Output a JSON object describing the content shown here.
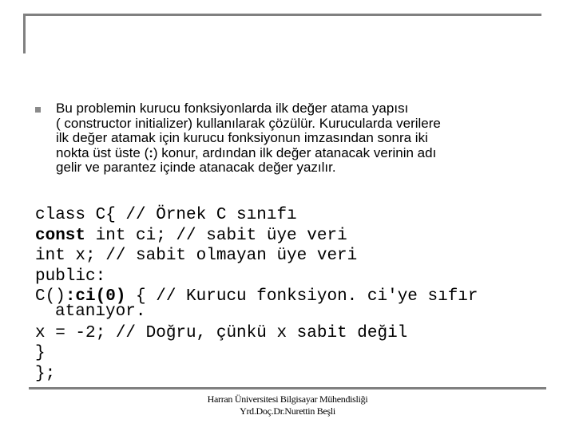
{
  "slide": {
    "bullet_icon": "square-bullet-icon",
    "bullet_lines": [
      "Bu problemin kurucu fonksiyonlarda ilk değer atama yapısı",
      "( constructor initializer) kullanılarak çözülür. Kurucularda verilere",
      "ilk değer atamak için kurucu fonksiyonun imzasından sonra iki",
      "nokta üst üste (",
      ":",
      ") konur, ardından ilk değer atanacak verinin adı",
      "gelir ve parantez içinde atanacak değer yazılır."
    ],
    "code": {
      "line1": "class C{ // Örnek C sınıfı",
      "line2_bold": "const",
      "line2_rest": " int ci; // sabit üye veri",
      "line3": "int x; // sabit olmayan üye veri",
      "line4": "public:",
      "line5_pre": "C()",
      "line5_bold": ":ci(0)",
      "line5_rest": " { // Kurucu fonksiyon. ci'ye sıfır",
      "line5_wrap": "atanıyor.",
      "line6": "x = -2; // Doğru, çünkü x sabit değil",
      "line7": "}",
      "line8": "};"
    },
    "footer": {
      "line1": "Harran Üniversitesi Bilgisayar Mühendisliği",
      "line2": "Yrd.Doç.Dr.Nurettin Beşli"
    }
  }
}
